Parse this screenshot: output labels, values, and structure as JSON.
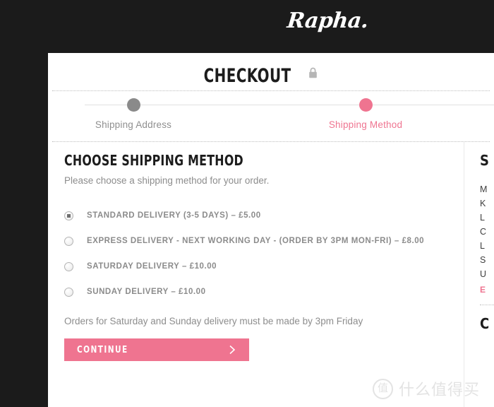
{
  "brand": {
    "logo_text": "Rapha."
  },
  "header": {
    "page_title": "CHECKOUT",
    "lock_icon": "lock-icon"
  },
  "progress": {
    "steps": [
      {
        "label": "Shipping Address",
        "state": "done"
      },
      {
        "label": "Shipping Method",
        "state": "active"
      }
    ]
  },
  "shipping_method": {
    "heading": "CHOOSE SHIPPING METHOD",
    "subtext": "Please choose a shipping method for your order.",
    "options": [
      {
        "label": "STANDARD DELIVERY (3-5 DAYS) – £5.00",
        "selected": true
      },
      {
        "label": "EXPRESS DELIVERY - NEXT WORKING DAY - (ORDER BY 3PM MON-FRI) – £8.00",
        "selected": false
      },
      {
        "label": "SATURDAY DELIVERY – £10.00",
        "selected": false
      },
      {
        "label": "SUNDAY DELIVERY – £10.00",
        "selected": false
      }
    ],
    "note": "Orders for Saturday and Sunday delivery must be made by 3pm Friday",
    "continue_label": "CONTINUE",
    "continue_icon": "chevron-right-icon"
  },
  "order_aside": {
    "heading": "S",
    "address_lines": [
      "M",
      "K",
      "L",
      "C",
      "L",
      "S",
      "U"
    ],
    "edit_label": "E",
    "second_heading": "C"
  },
  "watermark": {
    "badge": "值",
    "text": "什么值得买"
  },
  "colors": {
    "accent_pink": "#ef7490",
    "dark_header": "#1b1b1b",
    "muted_text": "#8d8d8d",
    "step_done": "#8a8a8a"
  }
}
